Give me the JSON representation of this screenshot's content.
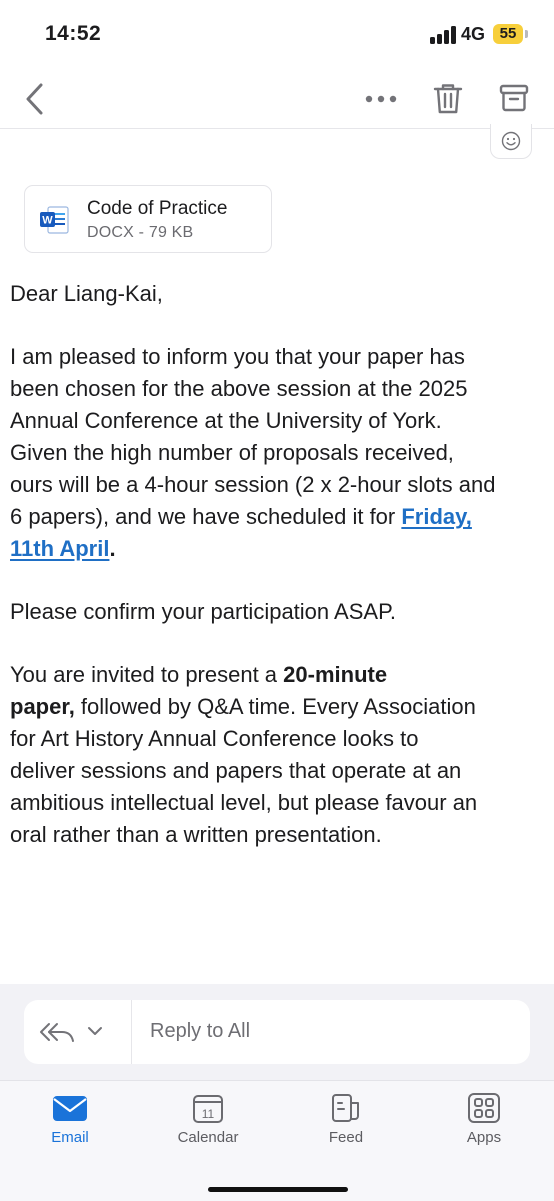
{
  "status_bar": {
    "time": "14:52",
    "network": "4G",
    "battery": "55",
    "battery_color": "#f7cf3b"
  },
  "nav": {
    "back_icon": "chevron-left-icon",
    "more_icon": "more-horizontal-icon",
    "delete_icon": "trash-icon",
    "archive_icon": "archive-icon"
  },
  "reaction_icon": "smiley-icon",
  "attachment": {
    "name": "Code of Practice",
    "meta": "DOCX - 79 KB",
    "icon": "word-doc-icon",
    "brand_color": "#185abd"
  },
  "email": {
    "greeting": "Dear Liang-Kai,",
    "p1_lines": [
      "I am pleased to inform you that your paper has",
      "been chosen for the above session at the 2025",
      "Annual Conference at the University of York.",
      "Given the high number of proposals received,",
      "ours will be a 4-hour session (2 x 2-hour slots and",
      "6 papers), and we have scheduled it for "
    ],
    "date_link_1": "Friday,",
    "date_link_2": "11th April",
    "p1_end": ".",
    "p2": "Please confirm your participation ASAP.",
    "p3_start": "You are invited to present a ",
    "p3_bold_1": "20-minute",
    "p3_bold_2": "paper,",
    "p3_rest_1": " followed by Q&A time. Every Association",
    "p3_lines": [
      "for Art History Annual Conference looks to",
      "deliver sessions and papers that operate at an",
      "ambitious intellectual level, but please favour an",
      "oral rather than a written presentation."
    ],
    "link_color": "#1f6fc5"
  },
  "reply": {
    "placeholder": "Reply to All",
    "icon": "reply-all-icon",
    "dropdown_icon": "chevron-down-icon"
  },
  "tabs": [
    {
      "label": "Email",
      "icon": "mail-icon",
      "active": true
    },
    {
      "label": "Calendar",
      "icon": "calendar-icon",
      "day": "11"
    },
    {
      "label": "Feed",
      "icon": "feed-icon"
    },
    {
      "label": "Apps",
      "icon": "apps-grid-icon"
    }
  ],
  "accent_color": "#1a73d9"
}
